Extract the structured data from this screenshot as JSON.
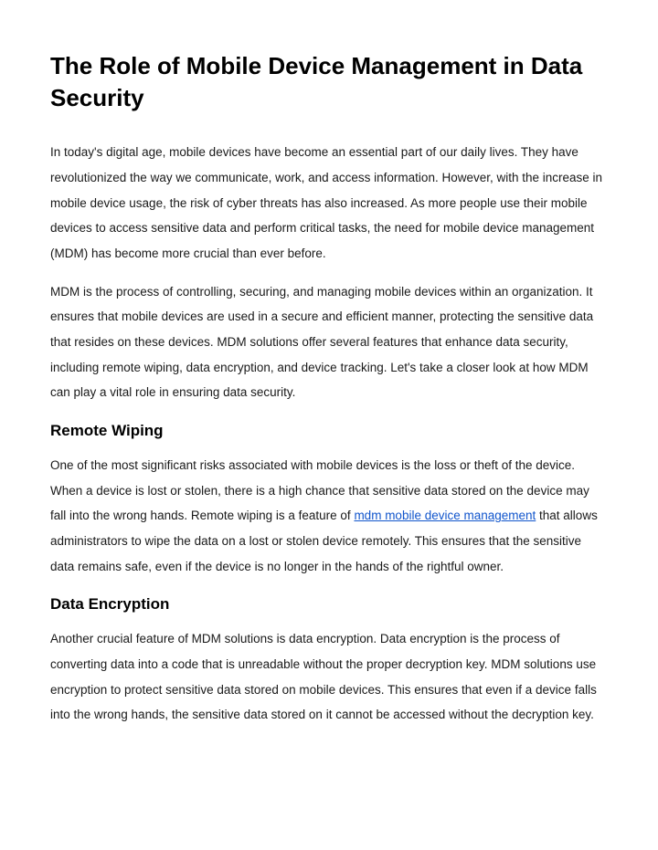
{
  "title": "The Role of Mobile Device Management in Data Security",
  "intro1": "In today's digital age, mobile devices have become an essential part of our daily lives. They have revolutionized the way we communicate, work, and access information. However, with the increase in mobile device usage, the risk of cyber threats has also increased. As more people use their mobile devices to access sensitive data and perform critical tasks, the need for mobile device management (MDM) has become more crucial than ever before.",
  "intro2": "MDM is the process of controlling, securing, and managing mobile devices within an organization. It ensures that mobile devices are used in a secure and efficient manner, protecting the sensitive data that resides on these devices. MDM solutions offer several features that enhance data security, including remote wiping, data encryption, and device tracking. Let's take a closer look at how MDM can play a vital role in ensuring data security.",
  "section1": {
    "heading": "Remote Wiping",
    "text_before_link": "One of the most significant risks associated with mobile devices is the loss or theft of the device. When a device is lost or stolen, there is a high chance that sensitive data stored on the device may fall into the wrong hands. Remote wiping is a feature of ",
    "link_text": "mdm mobile device management",
    "text_after_link": " that allows administrators to wipe the data on a lost or stolen device remotely. This ensures that the sensitive data remains safe, even if the device is no longer in the hands of the rightful owner."
  },
  "section2": {
    "heading": "Data Encryption",
    "text": "Another crucial feature of MDM solutions is data encryption. Data encryption is the process of converting data into a code that is unreadable without the proper decryption key. MDM solutions use encryption to protect sensitive data stored on mobile devices. This ensures that even if a device falls into the wrong hands, the sensitive data stored on it cannot be accessed without the decryption key."
  }
}
